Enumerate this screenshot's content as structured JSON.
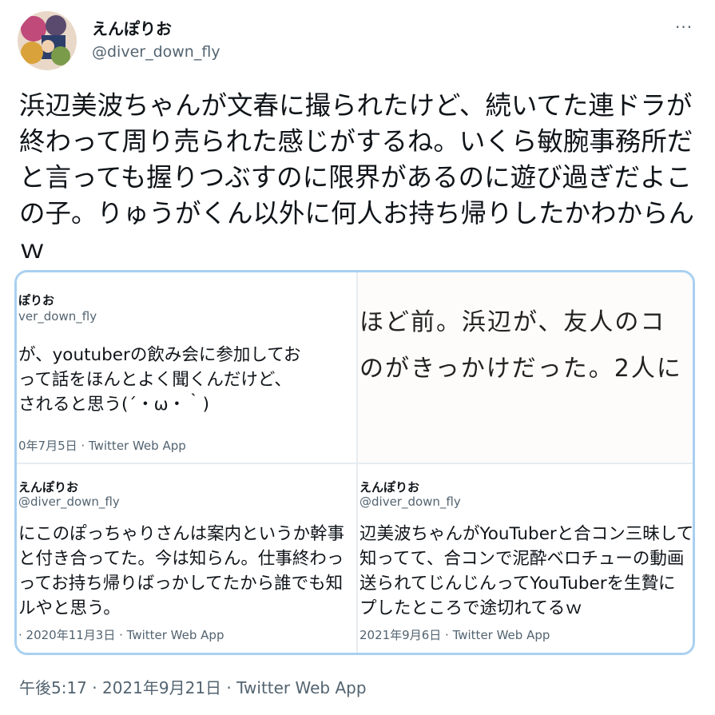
{
  "author": {
    "name": "えんぽりお",
    "handle": "@diver_down_fly"
  },
  "more_label": "···",
  "tweet_text": "浜辺美波ちゃんが文春に撮られたけど、続いてた連ドラが終わって周り売られた感じがするね。いくら敏腕事務所だと言っても握りつぶすのに限界があるのに遊び過ぎだよこの子。りゅうがくん以外に何人お持ち帰りしたかわからんｗ",
  "media": {
    "cell1": {
      "name": "ぽりお",
      "handle": "ver_down_fly",
      "lines": [
        "が、youtuberの飲み会に参加してお",
        "って話をほんとよく聞くんだけど、",
        "されると思う(´・ω・｀)"
      ],
      "meta": "0年7月5日 · Twitter Web App"
    },
    "cell2": {
      "lines": [
        "ほど前。浜辺が、友人のコ",
        "のがきっかけだった。2人に"
      ]
    },
    "cell3": {
      "name": "えんぽりお",
      "handle": "@diver_down_fly",
      "lines": [
        "にこのぽっちゃりさんは案内というか幹事",
        "と付き合ってた。今は知らん。仕事終わっ",
        "ってお持ち帰りばっかしてたから誰でも知",
        "ルやと思う。"
      ],
      "meta": "· 2020年11月3日 · Twitter Web App"
    },
    "cell4": {
      "name": "えんぽりお",
      "handle": "@diver_down_fly",
      "lines": [
        "辺美波ちゃんがYouTuberと合コン三昧して",
        "知ってて、合コンで泥酔ベロチューの動画",
        "送られてじんじんってYouTuberを生贄に",
        "プしたところで途切れてるｗ"
      ],
      "meta": "2021年9月6日 · Twitter Web App"
    }
  },
  "footer": "午後5:17 · 2021年9月21日 · Twitter Web App"
}
